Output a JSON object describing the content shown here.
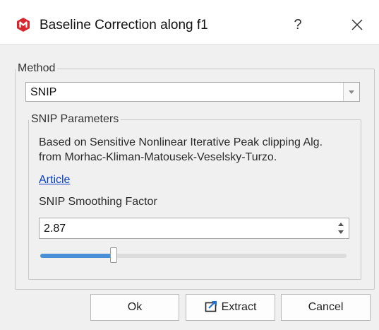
{
  "window": {
    "title": "Baseline Correction along f1",
    "help_label": "?",
    "app_icon": "mnova-logo-icon",
    "close_icon": "close-icon"
  },
  "method": {
    "group_label": "Method",
    "selected": "SNIP"
  },
  "snip": {
    "group_label": "SNIP Parameters",
    "description_line1": "Based on Sensitive Nonlinear Iterative Peak clipping Alg.",
    "description_line2": "from Morhac-Kliman-Matousek-Veselsky-Turzo.",
    "link_label": "Article",
    "smoothing_label": "SNIP Smoothing Factor",
    "smoothing_value": "2.87",
    "slider_fraction": 0.24
  },
  "buttons": {
    "ok": "Ok",
    "extract": "Extract",
    "cancel": "Cancel"
  },
  "colors": {
    "accent": "#4a90d9",
    "link": "#0a3fc4",
    "app_icon": "#d6262e"
  }
}
